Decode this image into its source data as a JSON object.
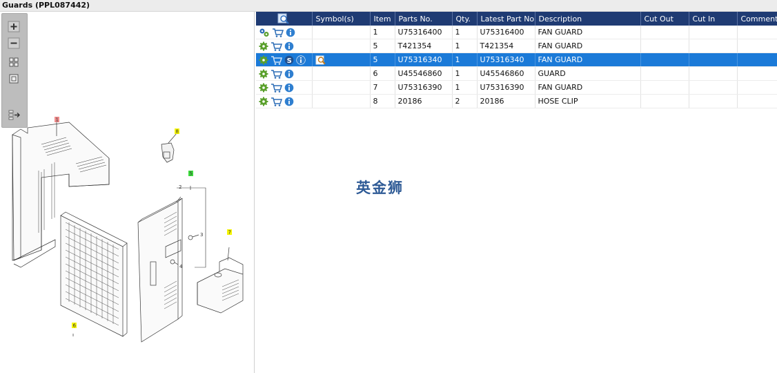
{
  "window": {
    "title": "Guards (PPL087442)"
  },
  "toolbar": {
    "buttons": [
      "zoom-in",
      "zoom-out",
      "fit-all",
      "actual-size",
      "export"
    ]
  },
  "drawing": {
    "callouts": [
      "1",
      "8",
      "2",
      "3",
      "4",
      "5",
      "6",
      "7"
    ],
    "callout_colors": {
      "1": "#f08c8c",
      "5": "#3ddc3d",
      "default": "#f5f500"
    }
  },
  "table": {
    "columns": [
      "",
      "Symbol(s)",
      "Item",
      "Parts No.",
      "Qty.",
      "Latest Part No.",
      "Description",
      "Cut Out",
      "Cut In",
      "Comment"
    ],
    "rows": [
      {
        "icons": [
          "gears-icon",
          "cart-icon",
          "info-icon"
        ],
        "symbols": "",
        "item": "1",
        "part": "U75316400",
        "qty": "1",
        "latest": "U75316400",
        "desc": "FAN GUARD",
        "cut_out": "",
        "cut_in": "",
        "comment": "",
        "selected": false
      },
      {
        "icons": [
          "gear-icon",
          "cart-icon",
          "info-icon"
        ],
        "symbols": "",
        "item": "5",
        "part": "T421354",
        "qty": "1",
        "latest": "T421354",
        "desc": "FAN GUARD",
        "cut_out": "",
        "cut_in": "",
        "comment": "",
        "selected": false
      },
      {
        "icons": [
          "gear-icon",
          "cart-icon",
          "s-badge-icon",
          "info-icon"
        ],
        "symbols": "magnify-doc-icon",
        "item": "5",
        "part": "U75316340",
        "qty": "1",
        "latest": "U75316340",
        "desc": "FAN GUARD",
        "cut_out": "",
        "cut_in": "",
        "comment": "",
        "selected": true
      },
      {
        "icons": [
          "gear-icon",
          "cart-icon",
          "info-icon"
        ],
        "symbols": "",
        "item": "6",
        "part": "U45546860",
        "qty": "1",
        "latest": "U45546860",
        "desc": "GUARD",
        "cut_out": "",
        "cut_in": "",
        "comment": "",
        "selected": false
      },
      {
        "icons": [
          "gear-icon",
          "cart-icon",
          "info-icon"
        ],
        "symbols": "",
        "item": "7",
        "part": "U75316390",
        "qty": "1",
        "latest": "U75316390",
        "desc": "FAN GUARD",
        "cut_out": "",
        "cut_in": "",
        "comment": "",
        "selected": false
      },
      {
        "icons": [
          "gear-icon",
          "cart-icon",
          "info-icon"
        ],
        "symbols": "",
        "item": "8",
        "part": "20186",
        "qty": "2",
        "latest": "20186",
        "desc": "HOSE CLIP",
        "cut_out": "",
        "cut_in": "",
        "comment": "",
        "selected": false
      }
    ]
  },
  "watermark": "英金狮",
  "colors": {
    "header": "#1f3b73",
    "selected": "#1b7ad8",
    "gear": "#5aa02c",
    "cart": "#2a6bb5",
    "info": "#2f7fd0"
  }
}
